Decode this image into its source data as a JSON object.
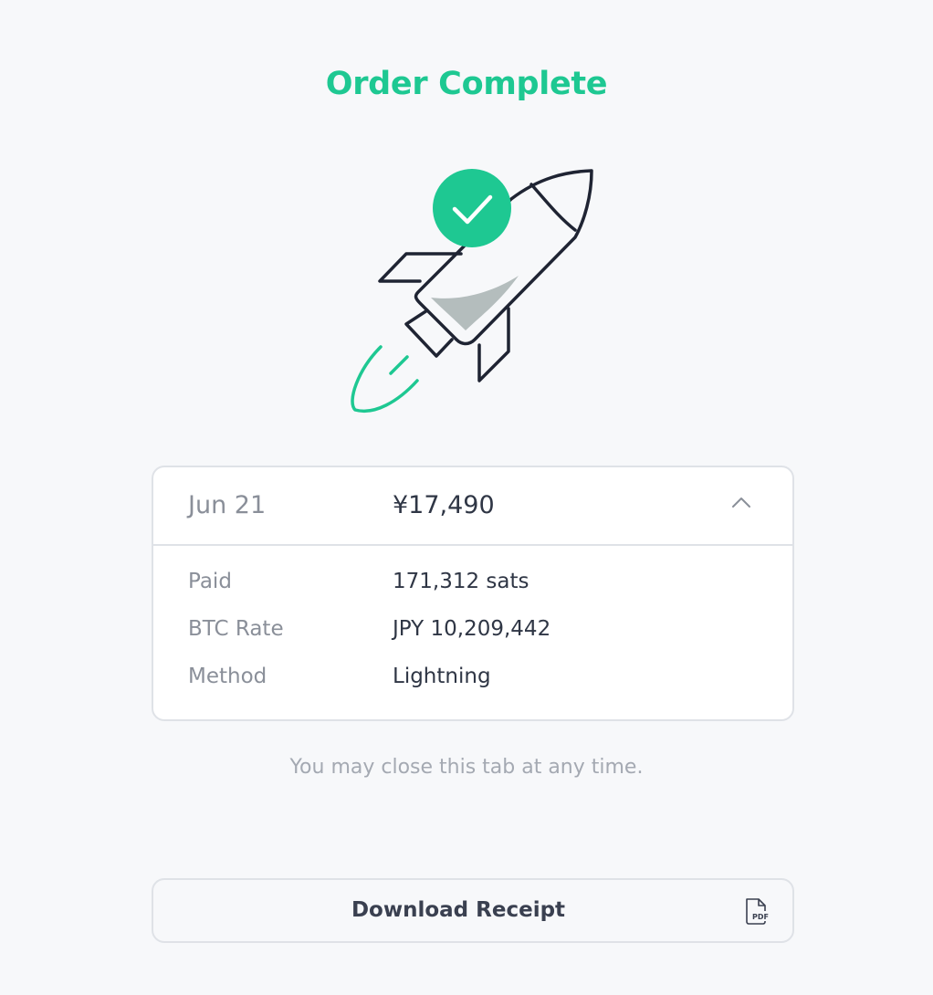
{
  "page": {
    "title": "Order Complete",
    "note": "You may close this tab at any time."
  },
  "order": {
    "date": "Jun 21",
    "amount": "¥17,490",
    "expanded": true,
    "details": [
      {
        "label": "Paid",
        "value": "171,312 sats"
      },
      {
        "label": "BTC Rate",
        "value": "JPY 10,209,442"
      },
      {
        "label": "Method",
        "value": "Lightning"
      }
    ]
  },
  "actions": {
    "download_label": "Download Receipt",
    "download_icon": "pdf-file-icon",
    "pdf_badge": "PDF"
  },
  "colors": {
    "accent": "#1ec892",
    "text": "#2f3645",
    "muted": "#8a8f99",
    "border": "#dfe2e7",
    "background": "#f7f8fa"
  },
  "illustration": {
    "icon": "rocket-icon",
    "badge": "checkmark-icon"
  }
}
